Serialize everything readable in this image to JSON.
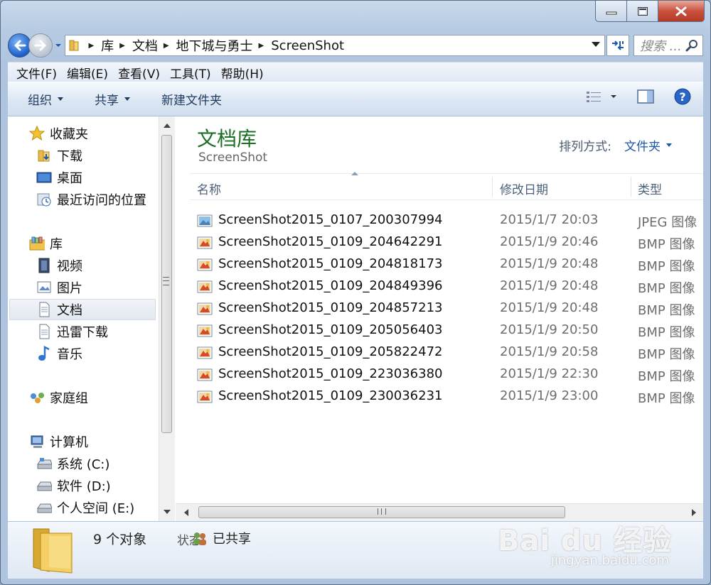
{
  "window": {
    "caption_min": "minimize",
    "caption_max": "maximize",
    "caption_close": "close"
  },
  "address": {
    "crumbs": [
      "库",
      "文档",
      "地下城与勇士",
      "ScreenShot"
    ],
    "search_placeholder": "搜索 ..."
  },
  "menu": {
    "file": "文件(F)",
    "edit": "编辑(E)",
    "view": "查看(V)",
    "tools": "工具(T)",
    "help": "帮助(H)"
  },
  "toolbar": {
    "organize": "组织",
    "share": "共享",
    "new_folder": "新建文件夹"
  },
  "nav": {
    "favorites": "收藏夹",
    "downloads": "下载",
    "desktop": "桌面",
    "recent": "最近访问的位置",
    "libraries": "库",
    "videos": "视频",
    "pictures": "图片",
    "documents": "文档",
    "xunlei": "迅雷下载",
    "music": "音乐",
    "homegroup": "家庭组",
    "computer": "计算机",
    "drive_c": "系统 (C:)",
    "drive_d": "软件 (D:)",
    "drive_e": "个人空间 (E:)"
  },
  "main": {
    "title": "文档库",
    "subtitle": "ScreenShot",
    "sort_label": "排列方式:",
    "sort_value": "文件夹",
    "col_name": "名称",
    "col_date": "修改日期",
    "col_type": "类型"
  },
  "files": [
    {
      "name": "ScreenShot2015_0107_200307994",
      "date": "2015/1/7 20:03",
      "type": "JPEG 图像",
      "icon": "jpeg-file-icon"
    },
    {
      "name": "ScreenShot2015_0109_204642291",
      "date": "2015/1/9 20:46",
      "type": "BMP 图像",
      "icon": "bmp-file-icon"
    },
    {
      "name": "ScreenShot2015_0109_204818173",
      "date": "2015/1/9 20:48",
      "type": "BMP 图像",
      "icon": "bmp-file-icon"
    },
    {
      "name": "ScreenShot2015_0109_204849396",
      "date": "2015/1/9 20:48",
      "type": "BMP 图像",
      "icon": "bmp-file-icon"
    },
    {
      "name": "ScreenShot2015_0109_204857213",
      "date": "2015/1/9 20:48",
      "type": "BMP 图像",
      "icon": "bmp-file-icon"
    },
    {
      "name": "ScreenShot2015_0109_205056403",
      "date": "2015/1/9 20:50",
      "type": "BMP 图像",
      "icon": "bmp-file-icon"
    },
    {
      "name": "ScreenShot2015_0109_205822472",
      "date": "2015/1/9 20:58",
      "type": "BMP 图像",
      "icon": "bmp-file-icon"
    },
    {
      "name": "ScreenShot2015_0109_223036380",
      "date": "2015/1/9 22:30",
      "type": "BMP 图像",
      "icon": "bmp-file-icon"
    },
    {
      "name": "ScreenShot2015_0109_230036231",
      "date": "2015/1/9 23:00",
      "type": "BMP 图像",
      "icon": "bmp-file-icon"
    }
  ],
  "status": {
    "count": "9 个对象",
    "state_label": "状态:",
    "state_value": "已共享"
  },
  "watermark": {
    "brand": "Bai du 经验",
    "url": "jingyan.baidu.com"
  },
  "colors": {
    "title_green": "#1a6f25",
    "link_blue": "#1e56a8",
    "close_red": "#c9523f"
  }
}
